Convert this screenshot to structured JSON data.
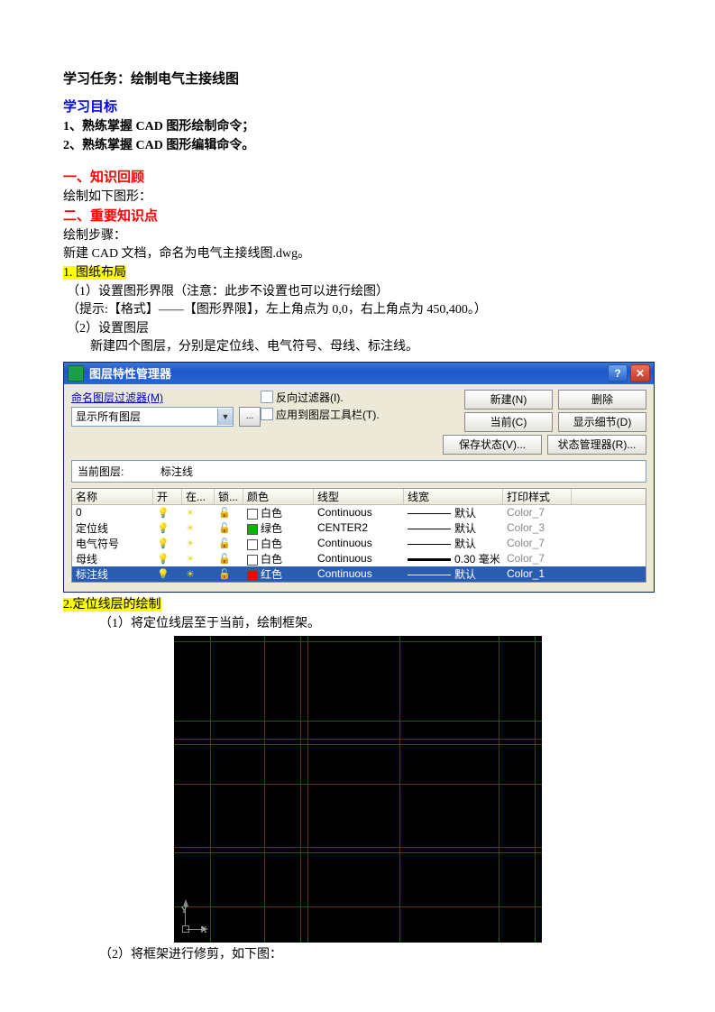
{
  "doc": {
    "task_title": "学习任务：绘制电气主接线图",
    "goals_title": "学习目标",
    "goal1": "1、熟练掌握 CAD 图形绘制命令；",
    "goal2": "2、熟练掌握 CAD 图形编辑命令。",
    "sec1_title": "一、知识回顾",
    "sec1_line1": "绘制如下图形：",
    "sec2_title": "二、重要知识点",
    "sec2_line1": "绘制步骤：",
    "sec2_line2": "新建 CAD 文档，命名为电气主接线图.dwg。",
    "step1_hl": "1. 图纸布局",
    "step1_a": "（1）设置图形界限（注意：此步不设置也可以进行绘图）",
    "step1_b": "（提示:【格式】——【图形界限】，左上角点为 0,0，右上角点为 450,400。）",
    "step1_c": "（2）设置图层",
    "step1_d": "新建四个图层，分别是定位线、电气符号、母线、标注线。",
    "step2_hl": "2.定位线层的绘制",
    "step2_a": "（1）将定位线层至于当前，绘制框架。",
    "step2_b": "（2）将框架进行修剪，如下图："
  },
  "window": {
    "title": "图层特性管理器",
    "help": "?",
    "close_icon": "✕",
    "filter_label": "命名图层过滤器(M)",
    "combo_value": "显示所有图层",
    "dots": "...",
    "chk_invert": "反向过滤器(I).",
    "chk_apply": "应用到图层工具栏(T).",
    "btn_new": "新建(N)",
    "btn_delete": "删除",
    "btn_current": "当前(C)",
    "btn_detail": "显示细节(D)",
    "btn_save": "保存状态(V)...",
    "btn_state": "状态管理器(R)...",
    "cur_layer_label": "当前图层:",
    "cur_layer_value": "标注线",
    "columns": {
      "name": "名称",
      "on": "开",
      "freeze": "在...",
      "lock": "锁...",
      "color": "颜色",
      "linetype": "线型",
      "lineweight": "线宽",
      "plot": "打印样式"
    },
    "rows": [
      {
        "name": "0",
        "color": "白色",
        "swatch": "white",
        "linetype": "Continuous",
        "lw": "默认",
        "lwthick": false,
        "plot": "Color_7"
      },
      {
        "name": "定位线",
        "color": "绿色",
        "swatch": "green",
        "linetype": "CENTER2",
        "lw": "默认",
        "lwthick": false,
        "plot": "Color_3"
      },
      {
        "name": "电气符号",
        "color": "白色",
        "swatch": "white",
        "linetype": "Continuous",
        "lw": "默认",
        "lwthick": false,
        "plot": "Color_7"
      },
      {
        "name": "母线",
        "color": "白色",
        "swatch": "white",
        "linetype": "Continuous",
        "lw": "0.30 毫米",
        "lwthick": true,
        "plot": "Color_7"
      },
      {
        "name": "标注线",
        "color": "红色",
        "swatch": "red",
        "linetype": "Continuous",
        "lw": "默认",
        "lwthick": false,
        "plot": "Color_1",
        "selected": true
      }
    ]
  },
  "cad": {
    "axis_y": "Y",
    "axis_x": "X"
  }
}
